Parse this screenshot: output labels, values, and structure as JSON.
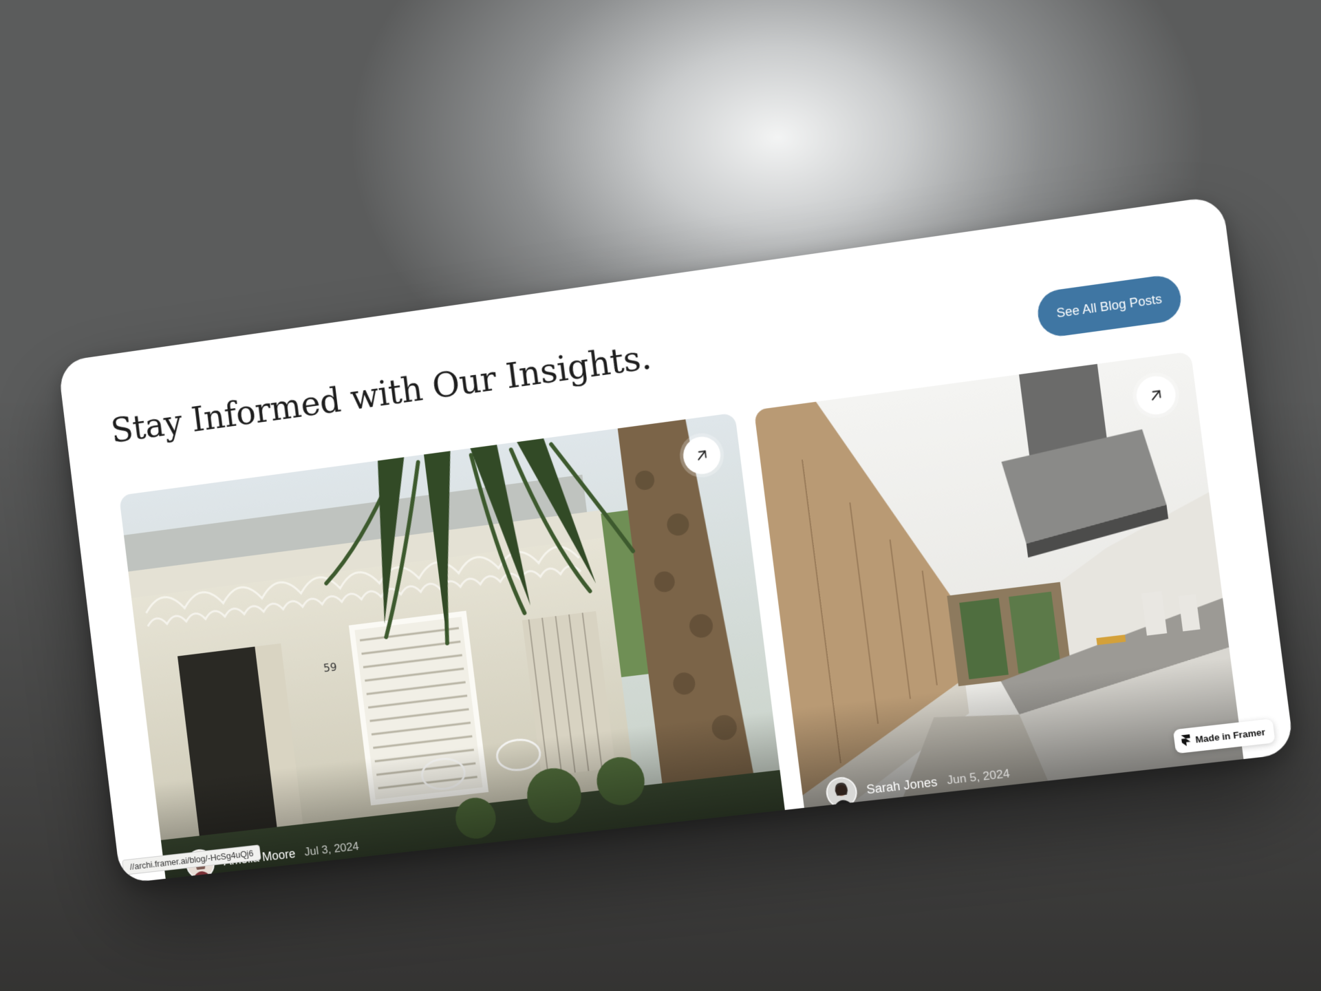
{
  "section": {
    "headline": "Stay Informed with Our Insights.",
    "cta_label": "See All Blog Posts"
  },
  "posts": [
    {
      "author": "Amelia Moore",
      "date": "Jul 3, 2024",
      "image_icon": "house-porch-photo",
      "action_icon": "arrow-up-right-icon"
    },
    {
      "author": "Sarah Jones",
      "date": "Jun 5, 2024",
      "image_icon": "kitchen-interior-photo",
      "action_icon": "arrow-up-right-icon"
    }
  ],
  "status_url": "//archi.framer.ai/blog/-HcSg4uQj6",
  "badge": {
    "label": "Made in Framer",
    "icon": "framer-logo-icon"
  },
  "colors": {
    "accent": "#3f76a3",
    "card": "#ffffff",
    "headline": "#1e1e1e"
  }
}
